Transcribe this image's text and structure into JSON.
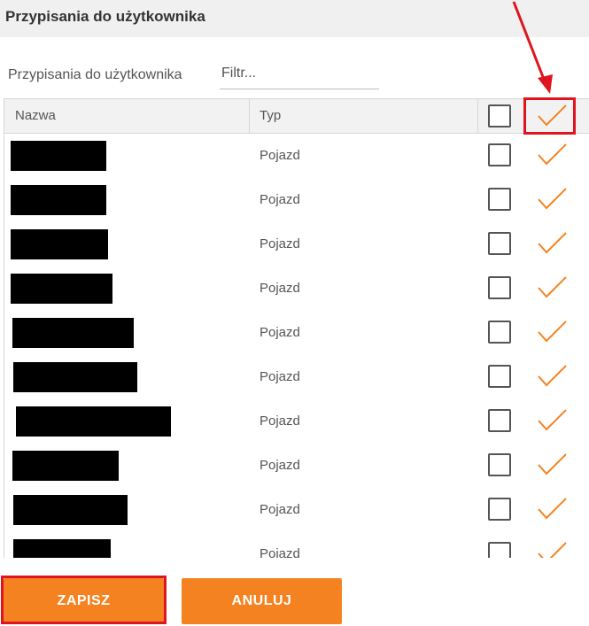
{
  "header": {
    "title": "Przypisania do użytkownika"
  },
  "filter": {
    "label": "Przypisania do użytkownika",
    "placeholder": "Filtr..."
  },
  "table": {
    "columns": {
      "name": "Nazwa",
      "type": "Typ"
    },
    "rows": [
      {
        "type": "Pojazd"
      },
      {
        "type": "Pojazd"
      },
      {
        "type": "Pojazd"
      },
      {
        "type": "Pojazd"
      },
      {
        "type": "Pojazd"
      },
      {
        "type": "Pojazd"
      },
      {
        "type": "Pojazd"
      },
      {
        "type": "Pojazd"
      },
      {
        "type": "Pojazd"
      },
      {
        "type": "Pojazd"
      }
    ]
  },
  "buttons": {
    "save": "ZAPISZ",
    "cancel": "ANULUJ"
  },
  "colors": {
    "accent": "#f58220",
    "highlight": "#e0141e"
  }
}
